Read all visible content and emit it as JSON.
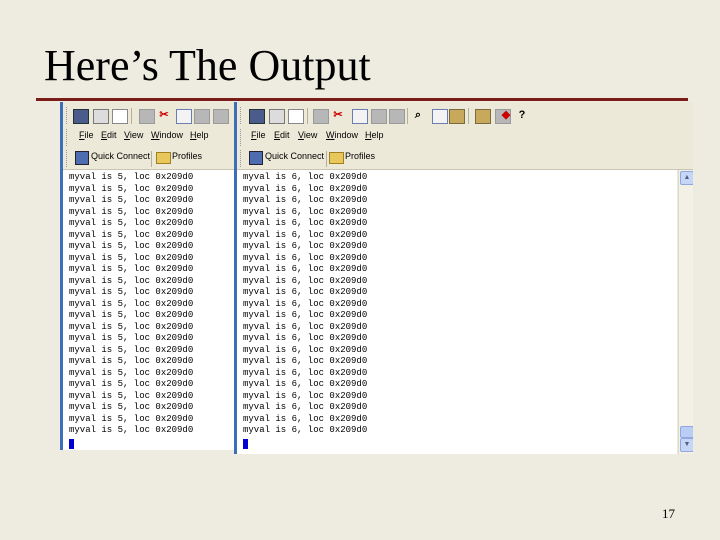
{
  "slide": {
    "title": "Here’s The Output",
    "page_number": "17",
    "accent_color": "#7a1d18"
  },
  "left_window": {
    "menu": [
      "File",
      "Edit",
      "View",
      "Window",
      "Help"
    ],
    "links": [
      {
        "label": "Quick Connect",
        "icon": "quick-connect-icon"
      },
      {
        "label": "Profiles",
        "icon": "folder-icon"
      }
    ],
    "lines": [
      "myval is 5, loc 0x209d0",
      "myval is 5, loc 0x209d0",
      "myval is 5, loc 0x209d0",
      "myval is 5, loc 0x209d0",
      "myval is 5, loc 0x209d0",
      "myval is 5, loc 0x209d0",
      "myval is 5, loc 0x209d0",
      "myval is 5, loc 0x209d0",
      "myval is 5, loc 0x209d0",
      "myval is 5, loc 0x209d0",
      "myval is 5, loc 0x209d0",
      "myval is 5, loc 0x209d0",
      "myval is 5, loc 0x209d0",
      "myval is 5, loc 0x209d0",
      "myval is 5, loc 0x209d0",
      "myval is 5, loc 0x209d0",
      "myval is 5, loc 0x209d0",
      "myval is 5, loc 0x209d0",
      "myval is 5, loc 0x209d0",
      "myval is 5, loc 0x209d0",
      "myval is 5, loc 0x209d0",
      "myval is 5, loc 0x209d0",
      "myval is 5, loc 0x209d0"
    ]
  },
  "right_window": {
    "menu": [
      "File",
      "Edit",
      "View",
      "Window",
      "Help"
    ],
    "links": [
      {
        "label": "Quick Connect",
        "icon": "quick-connect-icon"
      },
      {
        "label": "Profiles",
        "icon": "folder-icon"
      }
    ],
    "lines": [
      "myval is 6, loc 0x209d0",
      "myval is 6, loc 0x209d0",
      "myval is 6, loc 0x209d0",
      "myval is 6, loc 0x209d0",
      "myval is 6, loc 0x209d0",
      "myval is 6, loc 0x209d0",
      "myval is 6, loc 0x209d0",
      "myval is 6, loc 0x209d0",
      "myval is 6, loc 0x209d0",
      "myval is 6, loc 0x209d0",
      "myval is 6, loc 0x209d0",
      "myval is 6, loc 0x209d0",
      "myval is 6, loc 0x209d0",
      "myval is 6, loc 0x209d0",
      "myval is 6, loc 0x209d0",
      "myval is 6, loc 0x209d0",
      "myval is 6, loc 0x209d0",
      "myval is 6, loc 0x209d0",
      "myval is 6, loc 0x209d0",
      "myval is 6, loc 0x209d0",
      "myval is 6, loc 0x209d0",
      "myval is 6, loc 0x209d0",
      "myval is 6, loc 0x209d0"
    ]
  }
}
